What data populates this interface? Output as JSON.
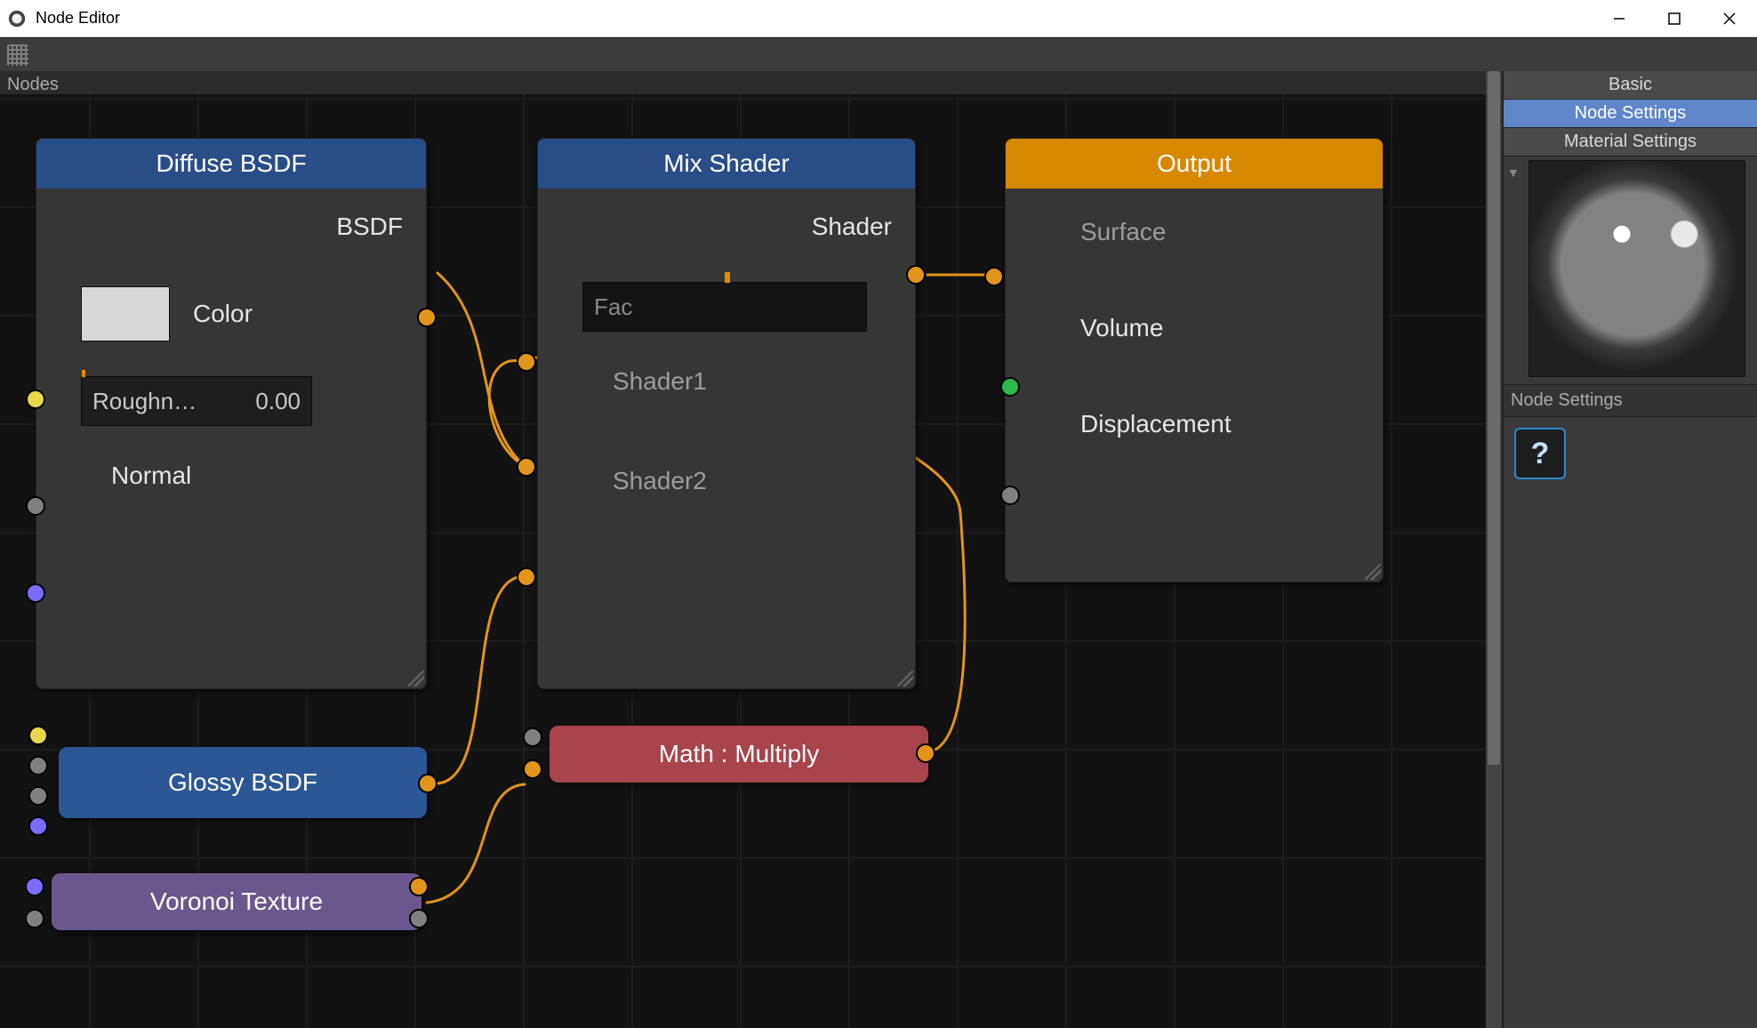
{
  "window": {
    "title": "Node Editor"
  },
  "panel": {
    "label": "Nodes"
  },
  "nodes": {
    "diffuse": {
      "title": "Diffuse BSDF",
      "out_bsdf": "BSDF",
      "color_label": "Color",
      "rough_label": "Roughn…",
      "rough_value": "0.00",
      "normal_label": "Normal"
    },
    "mix": {
      "title": "Mix Shader",
      "out_shader": "Shader",
      "fac_label": "Fac",
      "shader1": "Shader1",
      "shader2": "Shader2"
    },
    "output": {
      "title": "Output",
      "surface": "Surface",
      "volume": "Volume",
      "displacement": "Displacement"
    },
    "glossy": {
      "title": "Glossy BSDF"
    },
    "voronoi": {
      "title": "Voronoi Texture"
    },
    "math": {
      "title": "Math : Multiply"
    }
  },
  "inspector": {
    "tab_basic": "Basic",
    "tab_node": "Node Settings",
    "tab_material": "Material Settings",
    "section": "Node Settings"
  }
}
